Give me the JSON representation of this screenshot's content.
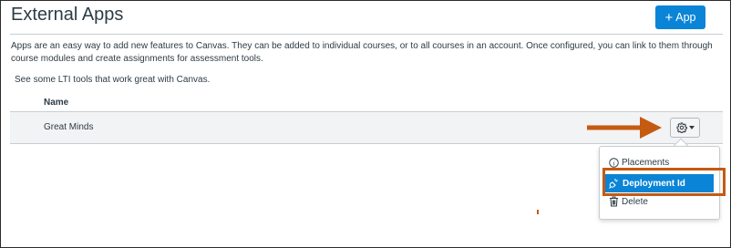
{
  "page": {
    "title": "External Apps",
    "add_button_plus": "+",
    "add_button_label": "App",
    "description": "Apps are an easy way to add new features to Canvas. They can be added to individual courses, or to all courses in an account. Once configured, you can link to them through course modules and create assignments for assessment tools.",
    "lti_note": "See some LTI tools that work great with Canvas."
  },
  "table": {
    "columns": [
      "Name"
    ],
    "rows": [
      {
        "name": "Great Minds"
      }
    ]
  },
  "menu": {
    "items": [
      {
        "label": "Placements",
        "icon": "info-icon"
      },
      {
        "label": "Deployment Id",
        "icon": "plug-icon"
      },
      {
        "label": "Delete",
        "icon": "trash-icon"
      }
    ],
    "highlighted_index": 1
  },
  "colors": {
    "accent": "#0a84d6",
    "annotation": "#c55a11",
    "text": "#2d3b45",
    "row_background": "#f2f3f4"
  }
}
